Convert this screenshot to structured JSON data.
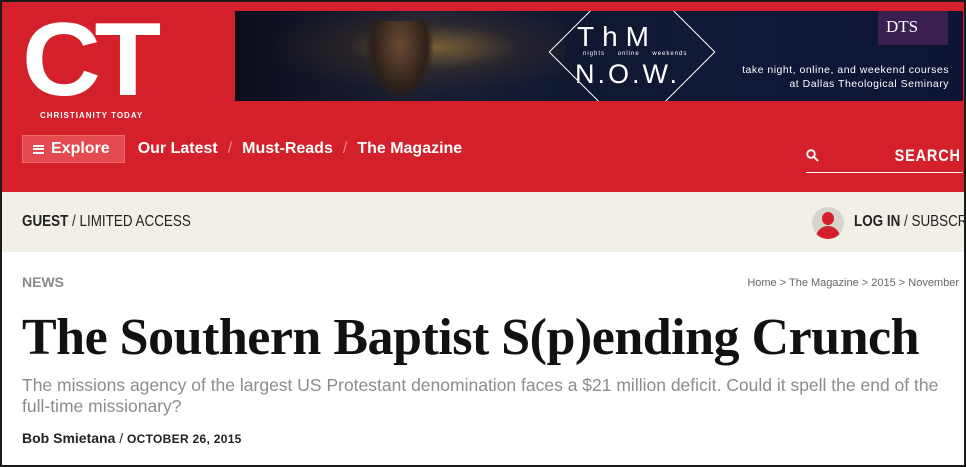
{
  "brand": {
    "logo_text": "CT",
    "logo_subtitle": "CHRISTIANITY TODAY",
    "accent_color": "#d4202a"
  },
  "ad": {
    "headline_top": "ThM",
    "small_words": [
      "nights",
      "online",
      "weekends"
    ],
    "headline_bottom": "N.O.W.",
    "sponsor": "DTS",
    "tagline_1": "take night, online, and weekend courses",
    "tagline_2": "at Dallas Theological Seminary"
  },
  "nav": {
    "explore_label": "Explore",
    "items": [
      {
        "label": "Our Latest"
      },
      {
        "label": "Must-Reads"
      },
      {
        "label": "The Magazine"
      }
    ],
    "separator": "/"
  },
  "search": {
    "label": "SEARCH",
    "icon": "search-icon"
  },
  "account": {
    "status_strong": "GUEST",
    "status_rest": " / LIMITED ACCESS",
    "login_label": "LOG IN",
    "divider": " / ",
    "subscribe_label": "SUBSCRIBE",
    "avatar_icon": "user-avatar-icon"
  },
  "article": {
    "section": "NEWS",
    "breadcrumb": "Home > The Magazine > 2015 > November",
    "title": "The Southern Baptist S(p)ending Crunch",
    "dek": "The missions agency of the largest US Protestant denomination faces a $21 million deficit. Could it spell the end of the full-time missionary?",
    "author": "Bob Smietana",
    "byline_sep": " / ",
    "date": "OCTOBER 26, 2015"
  }
}
